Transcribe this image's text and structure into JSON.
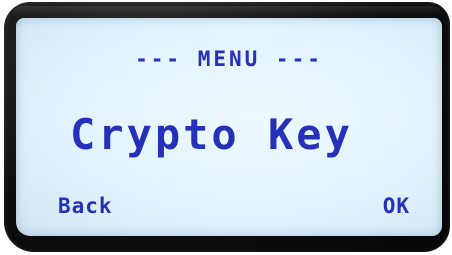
{
  "menu": {
    "title": "--- MENU ---",
    "item": "Crypto Key"
  },
  "softkeys": {
    "left": "Back",
    "right": "OK"
  },
  "colors": {
    "lcd_text": "#2431b8",
    "lcd_background": "#e2f2fc",
    "bezel": "#0d0d0d"
  }
}
